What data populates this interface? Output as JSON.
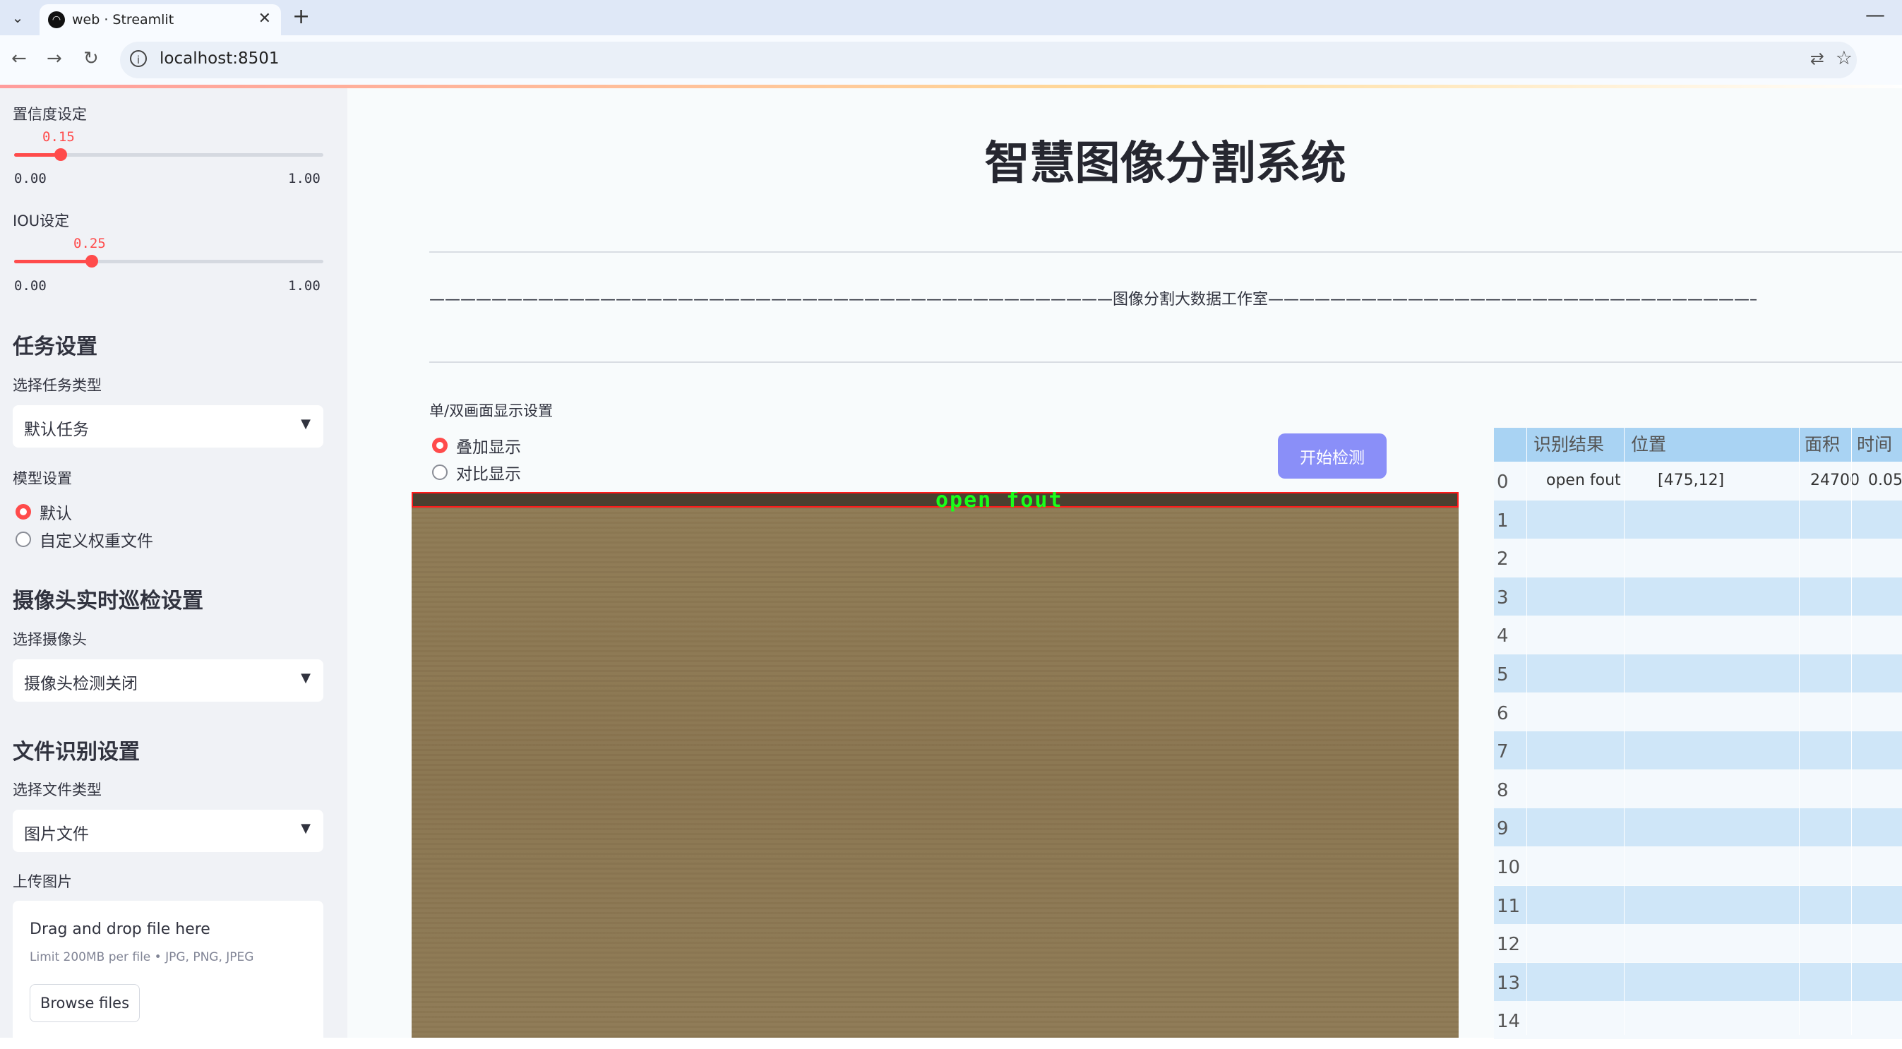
{
  "browser": {
    "tab_title": "web · Streamlit",
    "url": "localhost:8501"
  },
  "sidebar": {
    "confidence": {
      "label": "置信度设定",
      "value": "0.15",
      "fraction": 0.15,
      "min": "0.00",
      "max": "1.00"
    },
    "iou": {
      "label": "IOU设定",
      "value": "0.25",
      "fraction": 0.25,
      "min": "0.00",
      "max": "1.00"
    },
    "task_header": "任务设置",
    "task_type_label": "选择任务类型",
    "task_type_value": "默认任务",
    "model_label": "模型设置",
    "model_options": [
      "默认",
      "自定义权重文件"
    ],
    "model_selected": "默认",
    "camera_header": "摄像头实时巡检设置",
    "camera_label": "选择摄像头",
    "camera_value": "摄像头检测关闭",
    "file_header": "文件识别设置",
    "file_type_label": "选择文件类型",
    "file_type_value": "图片文件",
    "upload_label": "上传图片",
    "upload": {
      "title": "Drag and drop file here",
      "limit": "Limit 200MB per file • JPG, PNG, JPEG",
      "button": "Browse files"
    }
  },
  "main": {
    "title": "智慧图像分割系统",
    "subtitle": "————————————————————————————————————————————图像分割大数据工作室———————————————————————————————————————————",
    "display_label": "单/双画面显示设置",
    "display_options": [
      "叠加显示",
      "对比显示"
    ],
    "display_selected": "叠加显示",
    "start_button": "开始检测",
    "detection_label": "open fout"
  },
  "results_table": {
    "headers": [
      "识别结果",
      "位置",
      "面积",
      "时间"
    ],
    "rows": [
      {
        "index": "0",
        "result": "open fout",
        "position": "[475,12]",
        "area": "24700",
        "time": "0.05"
      },
      {
        "index": "1",
        "result": "",
        "position": "",
        "area": "",
        "time": ""
      },
      {
        "index": "2",
        "result": "",
        "position": "",
        "area": "",
        "time": ""
      },
      {
        "index": "3",
        "result": "",
        "position": "",
        "area": "",
        "time": ""
      },
      {
        "index": "4",
        "result": "",
        "position": "",
        "area": "",
        "time": ""
      },
      {
        "index": "5",
        "result": "",
        "position": "",
        "area": "",
        "time": ""
      },
      {
        "index": "6",
        "result": "",
        "position": "",
        "area": "",
        "time": ""
      },
      {
        "index": "7",
        "result": "",
        "position": "",
        "area": "",
        "time": ""
      },
      {
        "index": "8",
        "result": "",
        "position": "",
        "area": "",
        "time": ""
      },
      {
        "index": "9",
        "result": "",
        "position": "",
        "area": "",
        "time": ""
      },
      {
        "index": "10",
        "result": "",
        "position": "",
        "area": "",
        "time": ""
      },
      {
        "index": "11",
        "result": "",
        "position": "",
        "area": "",
        "time": ""
      },
      {
        "index": "12",
        "result": "",
        "position": "",
        "area": "",
        "time": ""
      },
      {
        "index": "13",
        "result": "",
        "position": "",
        "area": "",
        "time": ""
      },
      {
        "index": "14",
        "result": "",
        "position": "",
        "area": "",
        "time": ""
      }
    ]
  },
  "colors": {
    "accent": "#ff4b4b",
    "button": "#8a8ff8",
    "table_header": "#a9d3f3",
    "table_row_alt": "#cfe6f8",
    "detection_box": "#ff1a1a",
    "detection_text": "#19ff19"
  }
}
